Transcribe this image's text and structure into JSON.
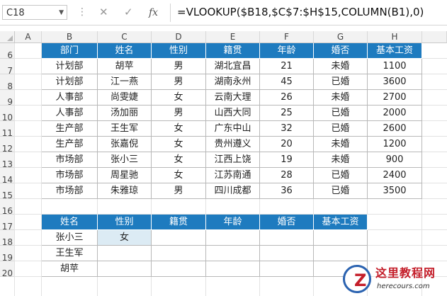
{
  "formula_bar": {
    "name_box": "C18",
    "cancel_icon": "close-icon",
    "confirm_icon": "check-icon",
    "fx_label": "fx",
    "formula": "=VLOOKUP($B18,$C$7:$H$15,COLUMN(B1),0)"
  },
  "columns": [
    "A",
    "B",
    "C",
    "D",
    "E",
    "F",
    "G",
    "H"
  ],
  "rows": [
    "6",
    "7",
    "8",
    "9",
    "10",
    "11",
    "12",
    "13",
    "14",
    "15",
    "16",
    "17",
    "18",
    "19",
    "20"
  ],
  "colors": {
    "header_fill": "#1e7bbf",
    "header_text": "#ffffff",
    "selected_fill": "#dcebf4"
  },
  "source_table": {
    "headers": [
      "部门",
      "姓名",
      "性别",
      "籍贯",
      "年龄",
      "婚否",
      "基本工资"
    ],
    "rows": [
      [
        "计划部",
        "胡苹",
        "男",
        "湖北宜昌",
        "21",
        "未婚",
        "1100"
      ],
      [
        "计划部",
        "江一燕",
        "男",
        "湖南永州",
        "45",
        "已婚",
        "3600"
      ],
      [
        "人事部",
        "尚雯婕",
        "女",
        "云南大理",
        "26",
        "未婚",
        "2700"
      ],
      [
        "人事部",
        "汤加丽",
        "男",
        "山西大同",
        "25",
        "已婚",
        "2000"
      ],
      [
        "生产部",
        "王生军",
        "女",
        "广东中山",
        "32",
        "已婚",
        "2600"
      ],
      [
        "生产部",
        "张嘉倪",
        "女",
        "贵州遵义",
        "20",
        "未婚",
        "1200"
      ],
      [
        "市场部",
        "张小三",
        "女",
        "江西上饶",
        "19",
        "未婚",
        "900"
      ],
      [
        "市场部",
        "周星驰",
        "女",
        "江苏南通",
        "28",
        "已婚",
        "2400"
      ],
      [
        "市场部",
        "朱雅琼",
        "男",
        "四川成都",
        "36",
        "已婚",
        "3500"
      ]
    ]
  },
  "lookup_table": {
    "headers": [
      "姓名",
      "性别",
      "籍贯",
      "年龄",
      "婚否",
      "基本工资"
    ],
    "rows": [
      [
        "张小三",
        "女",
        "",
        "",
        "",
        ""
      ],
      [
        "王生军",
        "",
        "",
        "",
        "",
        ""
      ],
      [
        "胡苹",
        "",
        "",
        "",
        "",
        ""
      ]
    ]
  },
  "watermark": {
    "title": "这里教程网",
    "url": "herecours.com"
  }
}
